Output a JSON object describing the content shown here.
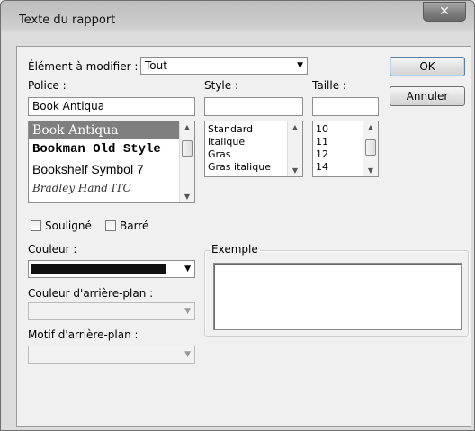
{
  "window": {
    "title": "Texte du rapport",
    "close_glyph": "✕"
  },
  "element": {
    "label": "Élément à modifier :",
    "value": "Tout"
  },
  "buttons": {
    "ok": "OK",
    "cancel": "Annuler"
  },
  "font": {
    "label": "Police :",
    "value": "Book Antiqua",
    "list": [
      "Book Antiqua",
      "Bookman Old Style",
      "Bookshelf Symbol 7",
      "Bradley Hand ITC"
    ],
    "selected_index": 0
  },
  "style": {
    "label": "Style :",
    "value": "",
    "list": [
      "Standard",
      "Italique",
      "Gras",
      "Gras italique"
    ]
  },
  "size": {
    "label": "Taille :",
    "value": "",
    "list": [
      "10",
      "11",
      "12",
      "14"
    ]
  },
  "effects": {
    "underline": "Souligné",
    "strikethrough": "Barré"
  },
  "color": {
    "label": "Couleur :",
    "value_hex": "#111111"
  },
  "bg_color": {
    "label": "Couleur d'arrière-plan :"
  },
  "bg_pattern": {
    "label": "Motif d'arrière-plan :"
  },
  "preview": {
    "label": "Exemple"
  },
  "icons": {
    "dropdown": "chevron-down-icon",
    "scroll_up": "scroll-up-arrow-icon",
    "scroll_down": "scroll-down-arrow-icon"
  },
  "colors": {
    "selection": "#7f7f7f",
    "title_bg": "#c8c8c8",
    "client_bg": "#f0f0f0"
  }
}
